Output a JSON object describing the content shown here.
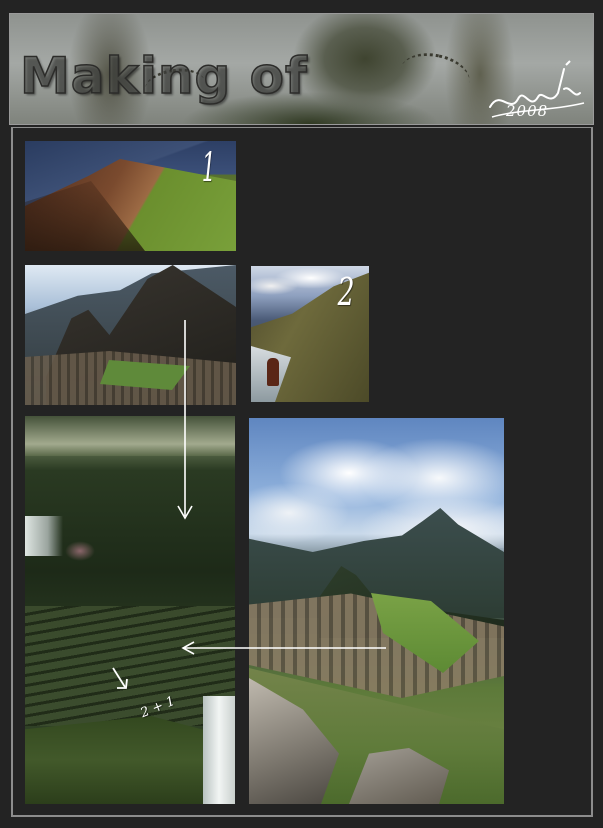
{
  "banner": {
    "title": "Making of",
    "year": "2008"
  },
  "photos": [
    {
      "name": "mountain-ridge-photo"
    },
    {
      "name": "machu-picchu-peak-photo"
    },
    {
      "name": "cliff-figure-photo"
    },
    {
      "name": "composite-jungle-artwork"
    },
    {
      "name": "machu-picchu-wide-photo"
    }
  ],
  "markers": {
    "one": "1",
    "two": "2",
    "sum": "2 + 1"
  },
  "colors": {
    "background": "#232323",
    "frame": "#8d8d8d",
    "annotation": "#ffffff"
  }
}
